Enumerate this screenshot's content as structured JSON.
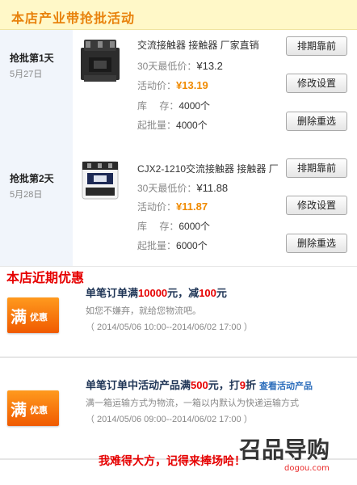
{
  "header": {
    "title": "本店产业带抢批活动"
  },
  "days": [
    {
      "day_label": "抢批第1天",
      "date": "5月27日",
      "product_name": "交流接触器 接触器 厂家直销",
      "low_price_label": "30天最低价：",
      "low_price": "¥13.2",
      "activity_label": "活动价：",
      "activity_price": "¥13.19",
      "stock_label": "库　 存：",
      "stock": "4000个",
      "min_label": "起批量：",
      "min_qty": "4000个",
      "btn_top": "排期靠前",
      "btn_edit": "修改设置",
      "btn_delete": "删除重选"
    },
    {
      "day_label": "抢批第2天",
      "date": "5月28日",
      "product_name": "CJX2-1210交流接触器 接触器 厂",
      "low_price_label": "30天最低价：",
      "low_price": "¥11.88",
      "activity_label": "活动价：",
      "activity_price": "¥11.87",
      "stock_label": "库　 存：",
      "stock": "6000个",
      "min_label": "起批量：",
      "min_qty": "6000个",
      "btn_top": "排期靠前",
      "btn_edit": "修改设置",
      "btn_delete": "删除重选"
    }
  ],
  "recent": {
    "title": "本店近期优惠",
    "promos": [
      {
        "badge_big": "满",
        "badge_small": "优惠",
        "title_pre": "单笔订单满",
        "title_amount": "10000",
        "title_mid": "元，减",
        "title_value": "100",
        "title_post": "元",
        "link": "",
        "desc": "如您不嫌弃，就给您物流吧。",
        "period": "（ 2014/05/06 10:00--2014/06/02 17:00 ）"
      },
      {
        "badge_big": "满",
        "badge_small": "优惠",
        "title_pre": "单笔订单中活动产品满",
        "title_amount": "500",
        "title_mid": "元，打",
        "title_value": "9",
        "title_post": "折",
        "link": "查看活动产品",
        "desc": "满一箱运输方式为物流，一箱以内默认为快递运输方式",
        "period": "（ 2014/05/06 09:00--2014/06/02 17:00 ）"
      }
    ]
  },
  "footer": {
    "slogan": "我难得大方，记得来捧场哈！"
  },
  "watermark": {
    "logo_text": "召品导购",
    "url_text": "dogou.com"
  },
  "colors": {
    "accent_orange": "#f08a00",
    "header_bg": "#fff8c8",
    "promo_red": "#e60000",
    "badge_orange": "#f05a00"
  }
}
